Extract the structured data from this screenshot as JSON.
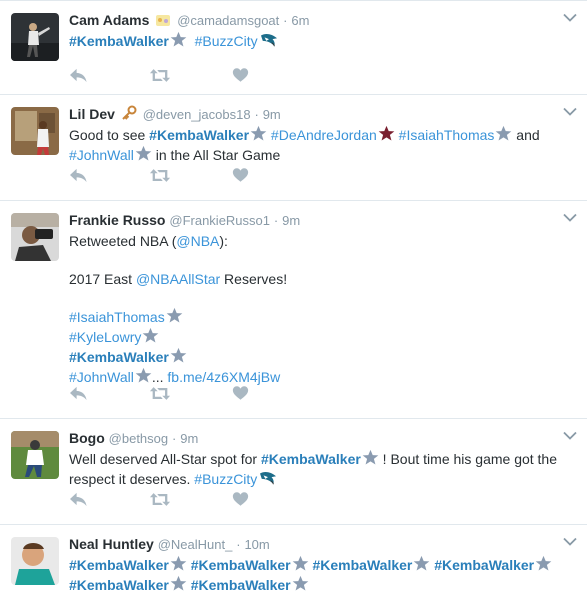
{
  "tweets": [
    {
      "name": "Cam Adams",
      "handle": "@camadamsgoat",
      "time": "6m",
      "line1_tags": [
        "#KembaWalker",
        "#BuzzCity"
      ]
    },
    {
      "name": "Lil Dev",
      "handle": "@deven_jacobs18",
      "time": "9m",
      "prefix": "Good to see ",
      "tags": [
        "#KembaWalker",
        "#DeAndreJordan",
        "#IsaiahThomas",
        "#JohnWall"
      ],
      "and": "and",
      "suffix": "in the All Star Game"
    },
    {
      "name": "Frankie Russo",
      "handle": "@FrankieRusso1",
      "time": "9m",
      "retweet_prefix": "Retweeted NBA (",
      "retweet_handle": "@NBA",
      "retweet_suffix": "):",
      "headline_prefix": "2017 East ",
      "headline_handle": "@NBAAllStar",
      "headline_suffix": " Reserves!",
      "tags": [
        "#IsaiahThomas",
        "#KyleLowry",
        "#KembaWalker",
        "#JohnWall"
      ],
      "ellipsis": "...",
      "short_link": "fb.me/4z6XM4jBw"
    },
    {
      "name": "Bogo",
      "handle": "@bethsog",
      "time": "9m",
      "prefix": "Well deserved All-Star spot for ",
      "tag": "#KembaWalker",
      "middle": " ! Bout time his game got the respect it deserves. ",
      "tag2": "#BuzzCity"
    },
    {
      "name": "Neal Huntley",
      "handle": "@NealHunt_",
      "time": "10m",
      "tag": "#KembaWalker"
    }
  ],
  "separator": "·",
  "colors": {
    "link": "#3b94d9",
    "hashtag_bold": "#2a7fba",
    "muted": "#8899a6",
    "star": "#8a9bb0",
    "star_red": "#7a2030"
  },
  "icons": [
    "reply-icon",
    "retweet-icon",
    "like-icon",
    "caret-down-icon",
    "star-icon",
    "hornet-icon",
    "key-icon",
    "basketball-icon"
  ]
}
